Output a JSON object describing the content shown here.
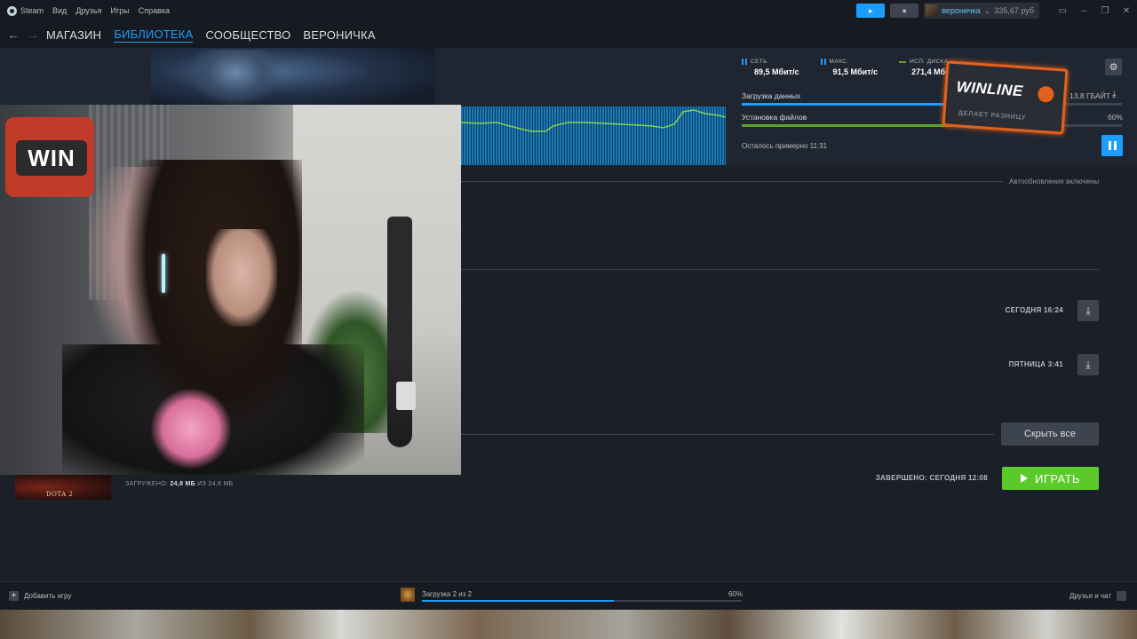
{
  "menubar": {
    "app": "Steam",
    "items": [
      "Вид",
      "Друзья",
      "Игры",
      "Справка"
    ]
  },
  "topright": {
    "user_name": "вероничка",
    "wallet": "335,67 руб"
  },
  "nav": {
    "tabs": [
      "МАГАЗИН",
      "БИБЛИОТЕКА",
      "СООБЩЕСТВО",
      "ВЕРОНИЧКА"
    ],
    "active_tab": "БИБЛИОТЕКА"
  },
  "downloads_header": {
    "stats": [
      {
        "label": "СЕТЬ",
        "value": "89,5 Мбит/с",
        "icon": "network-bar-icon"
      },
      {
        "label": "МАКС.",
        "value": "91,5 Мбит/с",
        "icon": "max-bar-icon"
      },
      {
        "label": "ИСП. ДИСКА",
        "value": "271,4 Мбит/с",
        "icon": "disk-line-icon"
      }
    ],
    "download_label": "Загрузка данных",
    "download_size": "13,8 ГБАЙТ",
    "download_progress": 0.8,
    "install_label": "Установка файлов",
    "install_percent": "60%",
    "install_progress": 0.6,
    "remaining_label": "Осталось примерно",
    "remaining_time": "11:31"
  },
  "overlay": {
    "brand": "WINLINE",
    "slogan": "ДЕЛАЕТ РАЗНИЦУ"
  },
  "webcam": {
    "sign": "WIN"
  },
  "queue": {
    "auto_updates": "Автообновления включены",
    "scheduled": [
      {
        "when": "СЕГОДНЯ 16:24"
      },
      {
        "when": "ПЯТНИЦА 3:41"
      }
    ],
    "hide_all": "Скрыть все"
  },
  "completed": {
    "game_label": "DOTA 2",
    "loaded_prefix": "ЗАГРУЖЕНО:",
    "loaded_value": "24,8 МБ",
    "loaded_of": "ИЗ 24,8 МБ",
    "finished": "ЗАВЕРШЕНО: СЕГОДНЯ 12:08",
    "play": "ИГРАТЬ"
  },
  "bottombar": {
    "add_game": "Добавить игру",
    "download_status": "Загрузка 2 из 2",
    "percent": "60%",
    "progress": 0.6,
    "friends": "Друзья и чат"
  },
  "colors": {
    "accent": "#1a9fff",
    "play": "#5cc92a",
    "disk_line": "#5ba32b",
    "winline": "#e2611c"
  }
}
